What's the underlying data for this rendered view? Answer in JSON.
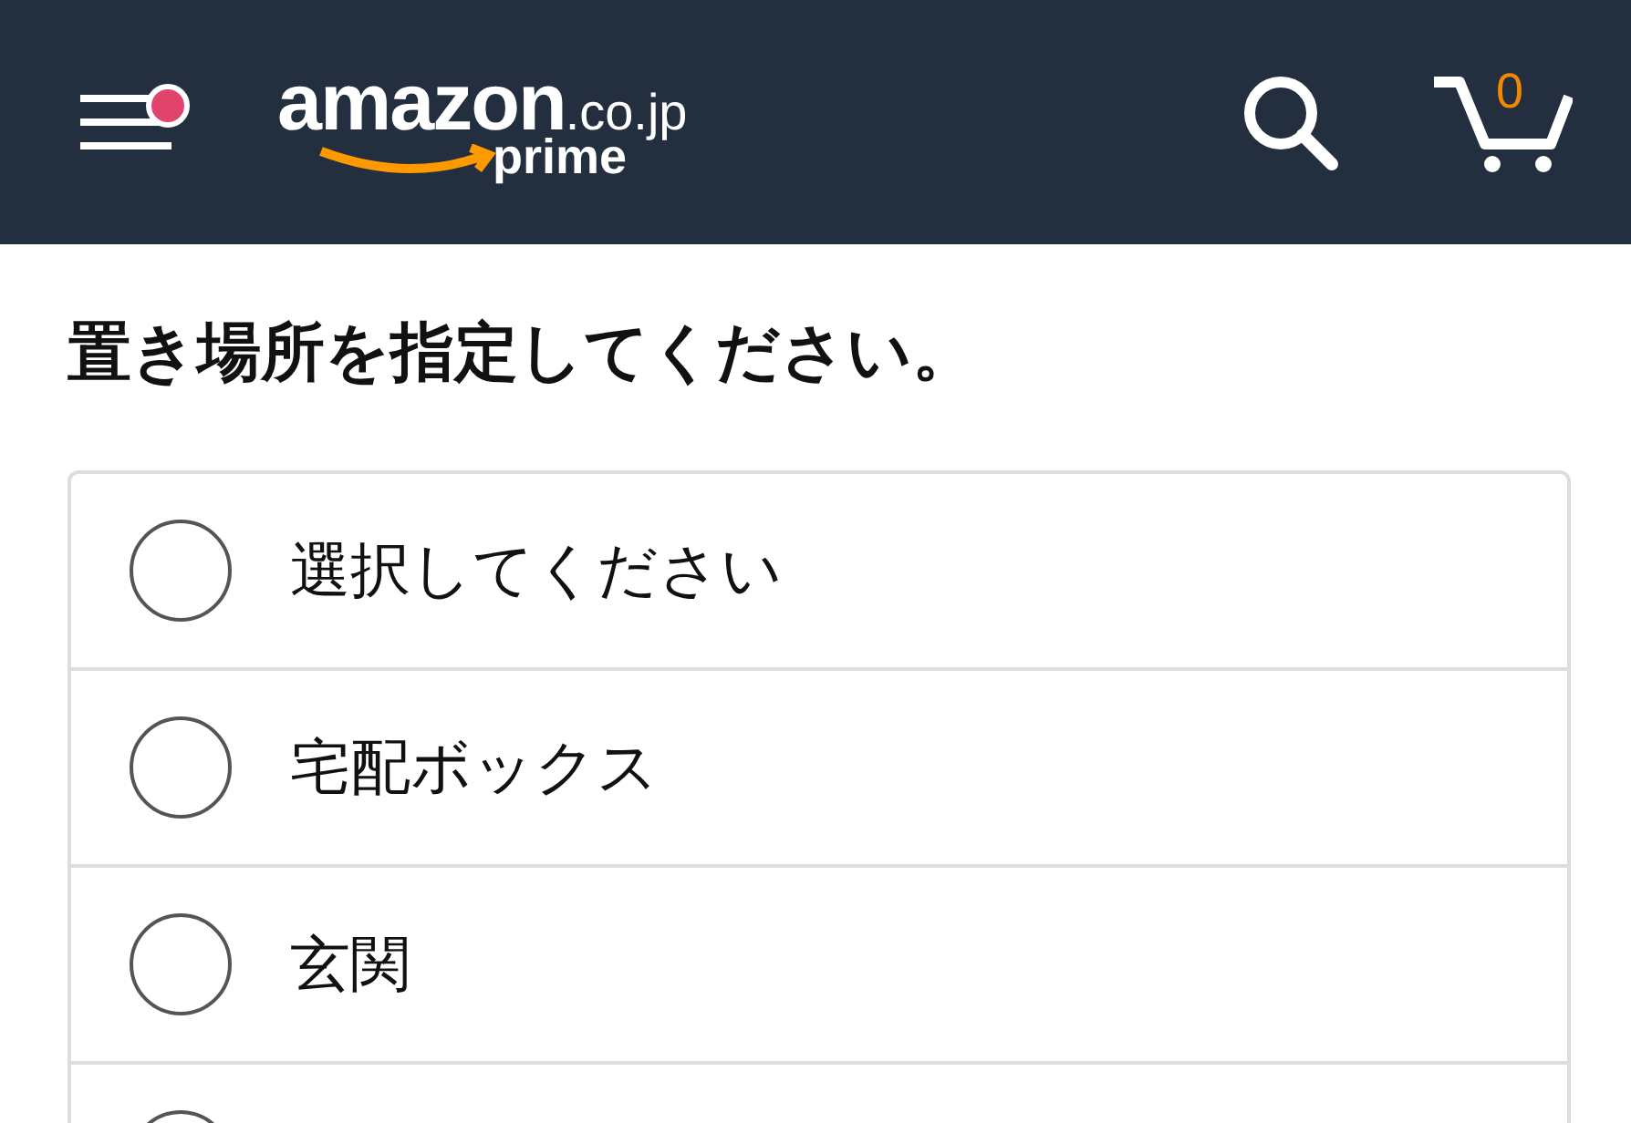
{
  "header": {
    "menu_badge": true,
    "logo": {
      "brand": "amazon",
      "domain": ".co.jp",
      "tier": "prime"
    },
    "cart_count": "0"
  },
  "title": "置き場所を指定してください。",
  "options": [
    {
      "label": "選択してください",
      "selected": false
    },
    {
      "label": "宅配ボックス",
      "selected": false
    },
    {
      "label": "玄関",
      "selected": false
    },
    {
      "selected": false
    }
  ]
}
